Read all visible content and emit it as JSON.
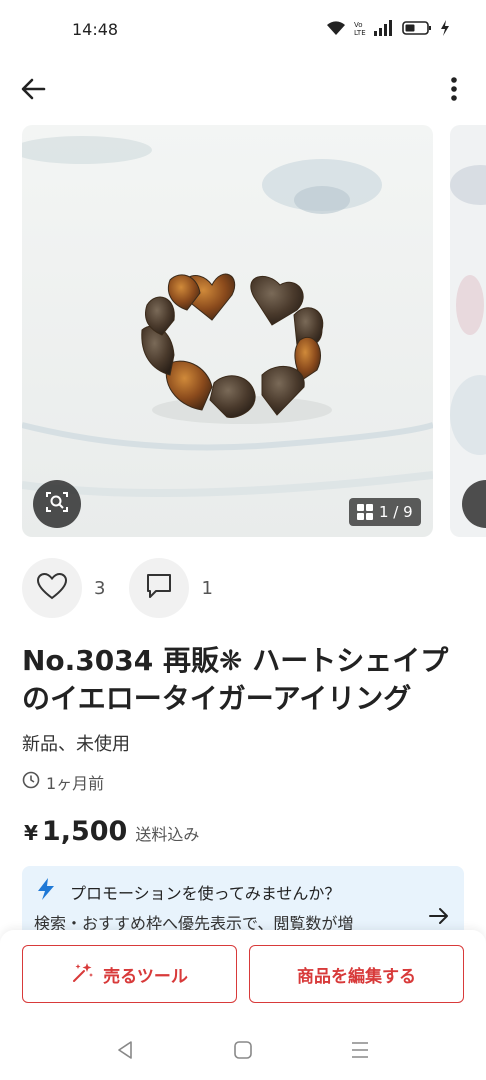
{
  "status_bar": {
    "time": "14:48",
    "icons": [
      "wifi-icon",
      "volte-icon",
      "signal-icon",
      "battery-icon",
      "charging-icon"
    ]
  },
  "app_bar": {
    "icons": [
      "back-arrow-icon",
      "more-vert-icon"
    ]
  },
  "gallery": {
    "counter": "1 / 9",
    "icons": [
      "lens-search-icon",
      "grid-icon"
    ]
  },
  "actions": {
    "likes": "3",
    "comments": "1",
    "icons": [
      "heart-icon",
      "comment-icon"
    ]
  },
  "item": {
    "title": "No.3034 再販❋ ハートシェイプのイエロータイガーアイリング",
    "condition": "新品、未使用",
    "posted": "1ヶ月前",
    "price_yen": "¥",
    "price_value": "1,500",
    "price_note": "送料込み"
  },
  "promo": {
    "title": "プロモーションを使ってみませんか？",
    "body": "検索・おすすめ枠へ優先表示で、閲覧数が増",
    "icons": [
      "lightning-icon",
      "arrow-right-icon"
    ]
  },
  "bottom_bar": {
    "sell_tool_label": "売るツール",
    "edit_label": "商品を編集する",
    "icons": [
      "sparkle-wand-icon"
    ]
  },
  "nav_bar": {
    "icons": [
      "nav-back-icon",
      "nav-home-icon",
      "nav-recents-icon"
    ]
  },
  "colors": {
    "accent_red": "#d83a3a",
    "promo_bg": "#e8f3fc",
    "lightning_blue": "#1e78d6"
  }
}
